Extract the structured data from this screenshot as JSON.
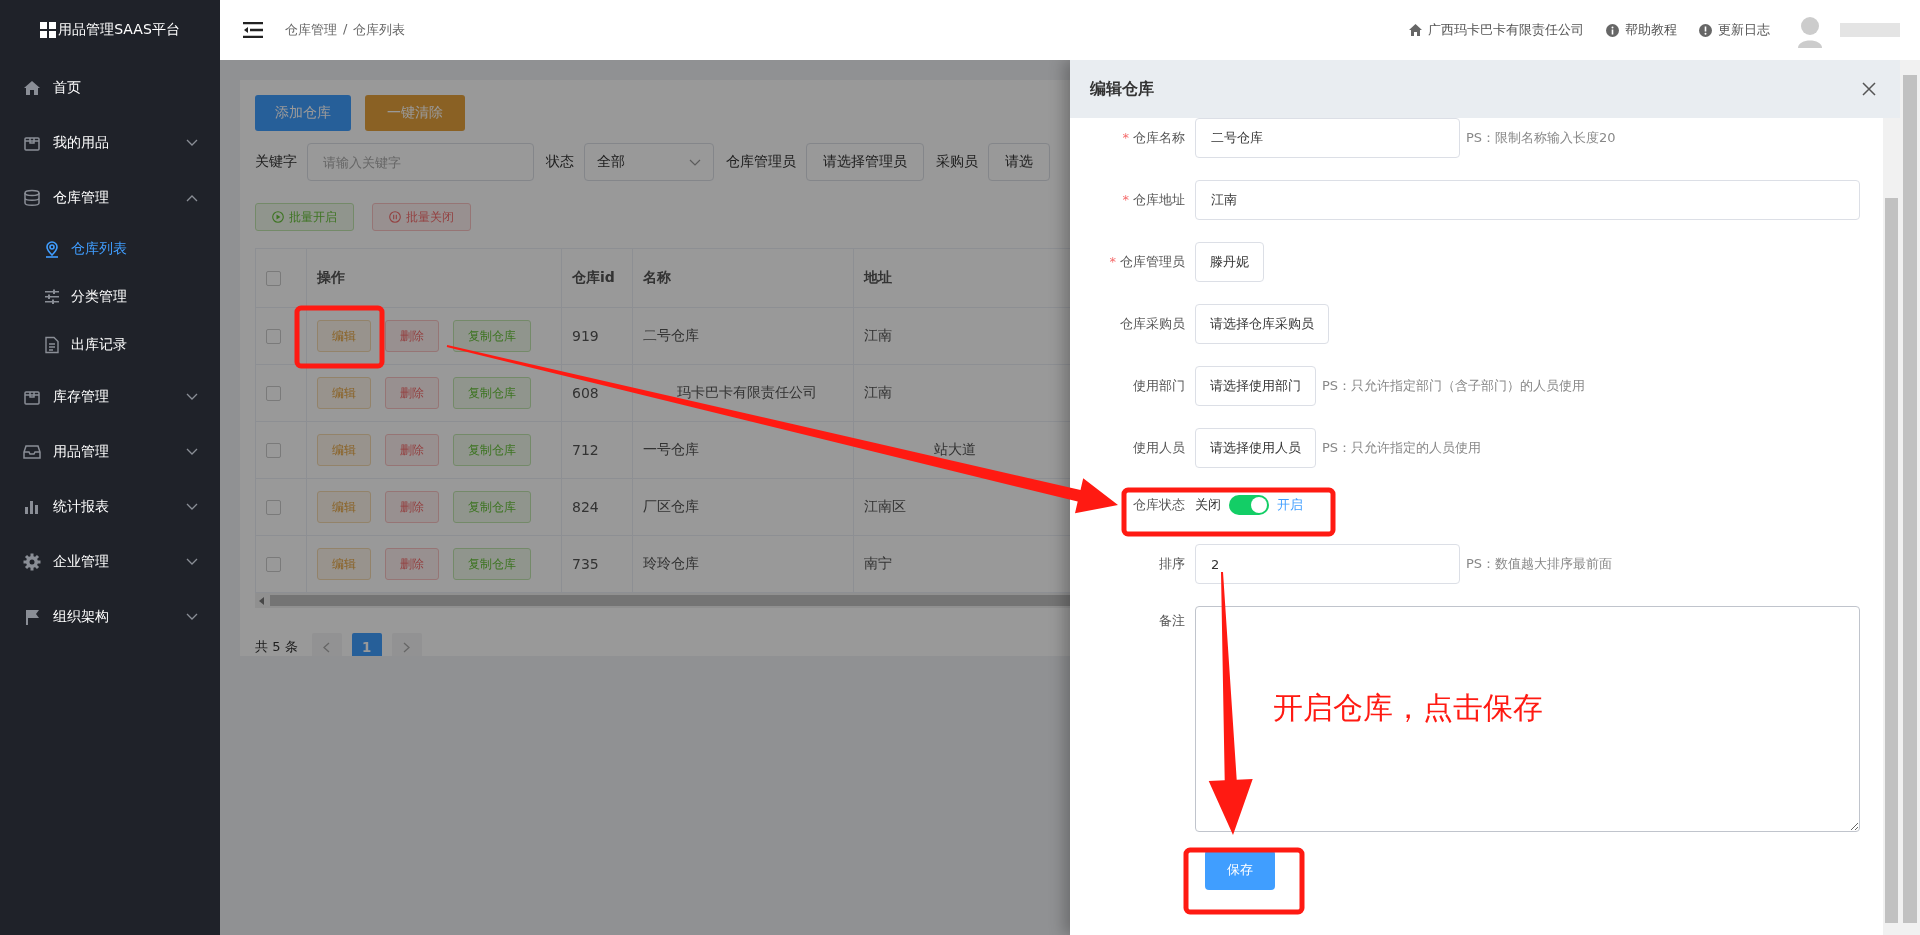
{
  "sidebar": {
    "logo": "用品管理SAAS平台",
    "items": [
      {
        "label": "首页"
      },
      {
        "label": "我的用品",
        "expanded": false
      },
      {
        "label": "仓库管理",
        "expanded": true,
        "children": [
          {
            "label": "仓库列表",
            "selected": true
          },
          {
            "label": "分类管理",
            "selected": false
          },
          {
            "label": "出库记录",
            "selected": false
          }
        ]
      },
      {
        "label": "库存管理",
        "expanded": false
      },
      {
        "label": "用品管理",
        "expanded": false
      },
      {
        "label": "统计报表",
        "expanded": false
      },
      {
        "label": "企业管理",
        "expanded": false
      },
      {
        "label": "组织架构",
        "expanded": false
      }
    ]
  },
  "topbar": {
    "breadcrumb": [
      "仓库管理",
      "仓库列表"
    ],
    "separator": "/",
    "company": "广西玛卡巴卡有限责任公司",
    "links": [
      "帮助教程",
      "更新日志"
    ]
  },
  "toolbar": {
    "buttons": [
      "添加仓库",
      "一键清除"
    ],
    "filters": [
      {
        "label": "关键字",
        "kind": "input",
        "placeholder": "请输入关键字"
      },
      {
        "label": "状态",
        "kind": "select",
        "value": "全部"
      },
      {
        "label": "仓库管理员",
        "kind": "picker",
        "value": "请选择管理员"
      },
      {
        "label": "采购员",
        "kind": "picker",
        "value": "请选"
      }
    ],
    "batch": [
      "批量开启",
      "批量关闭"
    ]
  },
  "table": {
    "all_checked": false,
    "columns": [
      "操作",
      "仓库id",
      "名称",
      "地址"
    ],
    "rows": [
      {
        "checked": false,
        "actions": [
          "编辑",
          "删除",
          "复制仓库"
        ],
        "id": "919",
        "name": "二号仓库",
        "address": "江南"
      },
      {
        "checked": false,
        "actions": [
          "编辑",
          "删除",
          "复制仓库"
        ],
        "id": "608",
        "name": "玛卡巴卡有限责任公司",
        "address": "江南"
      },
      {
        "checked": false,
        "actions": [
          "编辑",
          "删除",
          "复制仓库"
        ],
        "id": "712",
        "name": "一号仓库",
        "address": "站大道"
      },
      {
        "checked": false,
        "actions": [
          "编辑",
          "删除",
          "复制仓库"
        ],
        "id": "824",
        "name": "厂区仓库",
        "address": "江南区"
      },
      {
        "checked": false,
        "actions": [
          "编辑",
          "删除",
          "复制仓库"
        ],
        "id": "735",
        "name": "玲玲仓库",
        "address": "南宁"
      }
    ]
  },
  "pagination": {
    "total": "共 5 条",
    "pages": [
      {
        "label": "1",
        "selected": true
      }
    ]
  },
  "drawer": {
    "title": "编辑仓库",
    "required_mark": "*",
    "fields": [
      {
        "label": "仓库名称",
        "required": true,
        "kind": "input",
        "value": "二号仓库",
        "hint": "PS：限制名称输入长度20"
      },
      {
        "label": "仓库地址",
        "required": true,
        "kind": "wideinput",
        "value": "江南"
      },
      {
        "label": "仓库管理员",
        "required": true,
        "kind": "picker",
        "value": "滕丹妮"
      },
      {
        "label": "仓库采购员",
        "required": false,
        "kind": "picker",
        "value": "请选择仓库采购员"
      },
      {
        "label": "使用部门",
        "required": false,
        "kind": "picker",
        "value": "请选择使用部门",
        "hint": "PS：只允许指定部门（含子部门）的人员使用"
      },
      {
        "label": "使用人员",
        "required": false,
        "kind": "picker",
        "value": "请选择使用人员",
        "hint": "PS：只允许指定的人员使用"
      },
      {
        "label": "仓库状态",
        "required": false,
        "kind": "switch",
        "off_label": "关闭",
        "on_label": "开启",
        "on": true
      },
      {
        "label": "排序",
        "required": false,
        "kind": "input",
        "value": "2",
        "hint": "PS：数值越大排序最前面"
      },
      {
        "label": "备注",
        "required": false,
        "kind": "textarea"
      }
    ],
    "save_button": "保存"
  },
  "annotation": {
    "note": "开启仓库，点击保存"
  }
}
